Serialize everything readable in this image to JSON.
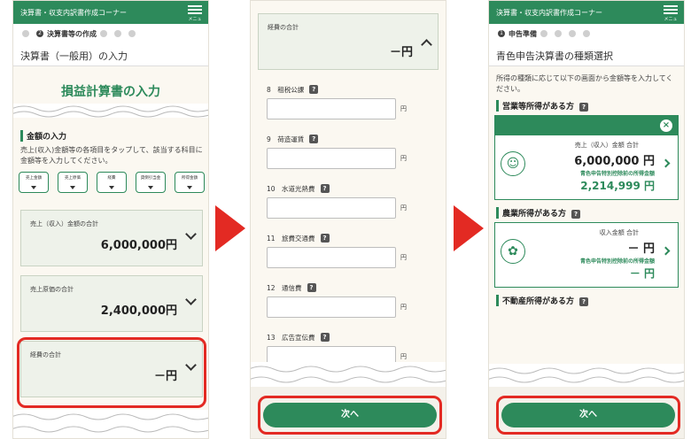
{
  "screen1": {
    "topbar_title": "決算書・収支内訳書作成コーナー",
    "menu_label": "メニュー",
    "step_text": "決算書等の作成",
    "step_number": "2",
    "page_heading": "決算書（一般用）の入力",
    "banner": "損益計算書の入力",
    "section_title": "金額の入力",
    "description": "売上(収入)金額等の各項目をタップして、該当する科目に金額等を入力してください。",
    "chips": [
      "売上金額",
      "売上原価",
      "経費",
      "貸倒引当金",
      "所得金額"
    ],
    "cards": [
      {
        "title": "売上（収入）金額の合計",
        "amount": "6,000,000円"
      },
      {
        "title": "売上原価の合計",
        "amount": "2,400,000円"
      },
      {
        "title": "経費の合計",
        "amount": "－円"
      }
    ]
  },
  "screen2": {
    "summary_title": "経費の合計",
    "summary_amount": "－円",
    "fields": [
      {
        "label": "8　租税公課",
        "unit": "円"
      },
      {
        "label": "9　荷造運賃",
        "unit": "円"
      },
      {
        "label": "10　水道光熱費",
        "unit": "円"
      },
      {
        "label": "11　旅費交通費",
        "unit": "円"
      },
      {
        "label": "12　通信費",
        "unit": "円"
      },
      {
        "label": "13　広告宣伝費",
        "unit": "円"
      }
    ],
    "help_icon": "?",
    "next_button": "次へ"
  },
  "screen3": {
    "topbar_title": "決算書・収支内訳書作成コーナー",
    "menu_label": "メニュー",
    "step_text": "申告準備",
    "step_number": "1",
    "page_heading": "青色申告決算書の種類選択",
    "description": "所得の種類に応じて以下の画面から金額等を入力してください。",
    "business": {
      "title": "営業等所得がある方",
      "close": "×",
      "label": "売上（収入）金額 合計",
      "amount": "6,000,000 円",
      "sub_label": "青色申告特別控除前の所得金額",
      "sub_amount": "2,214,999 円"
    },
    "agri": {
      "title": "農業所得がある方",
      "label": "収入金額 合計",
      "amount": "－ 円",
      "sub_label": "青色申告特別控除前の所得金額",
      "sub_amount": "－ 円"
    },
    "realestate_title": "不動産所得がある方",
    "next_button": "次へ"
  },
  "colors": {
    "accent": "#2d8a5b",
    "highlight": "#e32a23"
  }
}
